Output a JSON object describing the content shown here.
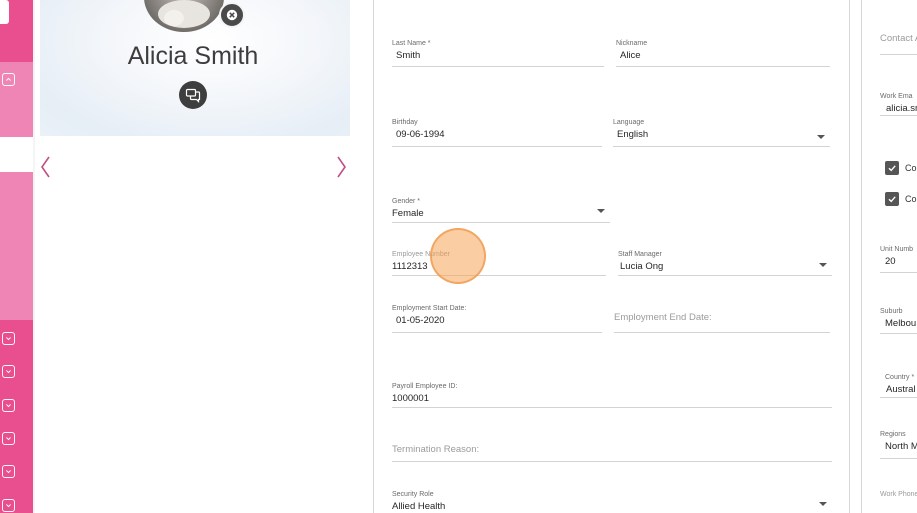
{
  "sidebar": {
    "icons": [
      "chevron-up-icon",
      "chevron-down-icon",
      "chevron-down-icon",
      "chevron-down-icon",
      "chevron-down-icon",
      "chevron-down-icon",
      "chevron-down-icon"
    ],
    "accent": "#e94e8f",
    "panel_color": "#ef85b4"
  },
  "profile": {
    "name": "Alicia Smith"
  },
  "form": {
    "last_name": {
      "label": "Last Name *",
      "value": "Smith"
    },
    "nickname": {
      "label": "Nickname",
      "value": "Alice"
    },
    "birthday": {
      "label": "Birthday",
      "value": "09-06-1994"
    },
    "language": {
      "label": "Language",
      "value": "English"
    },
    "gender": {
      "label": "Gender *",
      "value": "Female"
    },
    "employee_number": {
      "label": "Employee Number",
      "value": "1112313"
    },
    "staff_manager": {
      "label": "Staff Manager",
      "value": "Lucia Ong"
    },
    "employment_start": {
      "label": "Employment Start Date:",
      "value": "01-05-2020"
    },
    "employment_end": {
      "placeholder": "Employment End Date:"
    },
    "payroll_id": {
      "label": "Payroll Employee ID:",
      "value": "1000001"
    },
    "termination_reason": {
      "placeholder": "Termination Reason:"
    },
    "security_role": {
      "label": "Security Role",
      "value": "Allied Health"
    }
  },
  "right_panel": {
    "contact": "Contact A",
    "work_email_label": "Work Ema",
    "work_email_value": "alicia.sn",
    "checkbox1_label": "Co",
    "checkbox2_label": "Co",
    "unit_label": "Unit Numb",
    "unit_value": "20",
    "suburb_label": "Suburb",
    "suburb_value": "Melbou",
    "country_label": "Country *",
    "country_value": "Austral",
    "regions_label": "Regions",
    "regions_value": "North M",
    "work_phone_label": "Work Phone"
  }
}
